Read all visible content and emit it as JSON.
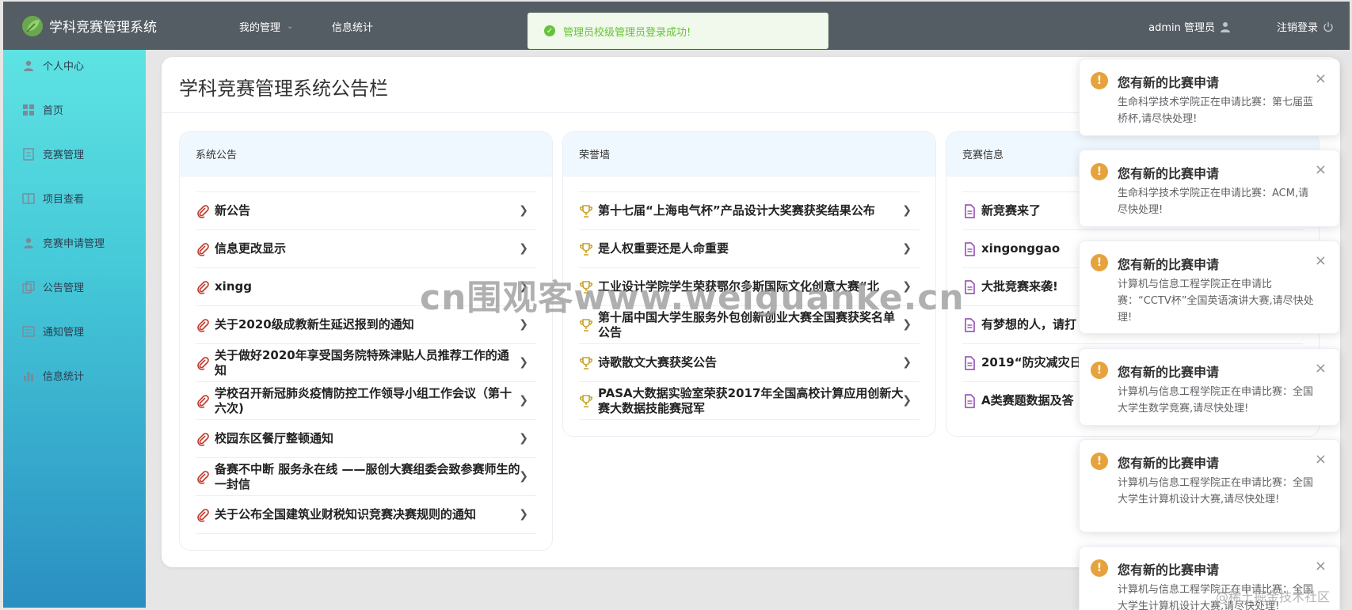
{
  "header": {
    "app_title": "学科竞赛管理系统",
    "nav": [
      {
        "label": "我的管理",
        "has_dropdown": true
      },
      {
        "label": "信息统计",
        "has_dropdown": false
      }
    ],
    "user_label": "admin 管理员",
    "logout_label": "注销登录",
    "bg_color": "#545c64"
  },
  "message": {
    "text": "管理员校级管理员登录成功!",
    "type": "success"
  },
  "sidebar": {
    "items": [
      {
        "label": "个人中心",
        "icon": "user-icon"
      },
      {
        "label": "首页",
        "icon": "grid-icon"
      },
      {
        "label": "竞赛管理",
        "icon": "file-icon"
      },
      {
        "label": "项目查看",
        "icon": "book-icon"
      },
      {
        "label": "竞赛申请管理",
        "icon": "user-icon"
      },
      {
        "label": "公告管理",
        "icon": "copy-icon"
      },
      {
        "label": "通知管理",
        "icon": "document-icon"
      },
      {
        "label": "信息统计",
        "icon": "bar-chart-icon"
      }
    ]
  },
  "main": {
    "title": "学科竞赛管理系统公告栏",
    "panels": [
      {
        "header": "系统公告",
        "icon": "paperclip-icon",
        "items": [
          "新公告",
          "信息更改显示",
          "xingg",
          "关于2020级成教新生延迟报到的通知",
          "关于做好2020年享受国务院特殊津贴人员推荐工作的通知",
          "学校召开新冠肺炎疫情防控工作领导小组工作会议（第十六次)",
          "校园东区餐厅整顿通知",
          "备赛不中断 服务永在线 ——服创大赛组委会致参赛师生的一封信",
          "关于公布全国建筑业财税知识竞赛决赛规则的通知"
        ]
      },
      {
        "header": "荣誉墙",
        "icon": "trophy-icon",
        "items": [
          "第十七届“上海电气杯”产品设计大奖赛获奖结果公布",
          "是人权重要还是人命重要",
          "工业设计学院学生荣获鄂尔多斯国际文化创意大赛“北",
          "第十届中国大学生服务外包创新创业大赛全国赛获奖名单公告",
          "诗歌散文大赛获奖公告",
          "PASA大数据实验室荣获2017年全国高校计算应用创新大赛大数据技能赛冠军"
        ]
      },
      {
        "header": "竞赛信息",
        "icon": "doc-icon",
        "items": [
          "新竞赛来了",
          "xingonggao",
          "大批竞赛来袭!",
          "有梦想的人，请打",
          "2019“防灾减灾日",
          "A类赛题数据及答"
        ]
      }
    ]
  },
  "notifications": [
    {
      "title": "您有新的比赛申请",
      "body": "生命科学技术学院正在申请比赛：第七届蓝桥杯,请尽快处理!"
    },
    {
      "title": "您有新的比赛申请",
      "body": "生命科学技术学院正在申请比赛：ACM,请尽快处理!"
    },
    {
      "title": "您有新的比赛申请",
      "body": "计算机与信息工程学院正在申请比赛：“CCTV杯”全国英语演讲大赛,请尽快处理!"
    },
    {
      "title": "您有新的比赛申请",
      "body": "计算机与信息工程学院正在申请比赛：全国大学生数学竞赛,请尽快处理!"
    },
    {
      "title": "您有新的比赛申请",
      "body": "计算机与信息工程学院正在申请比赛：全国大学生计算机设计大赛,请尽快处理!"
    },
    {
      "title": "您有新的比赛申请",
      "body": "计算机与信息工程学院正在申请比赛：全国大学生计算机设计大赛,请尽快处理!"
    }
  ],
  "watermark": {
    "main": "cn围观客www.weiguanke.cn",
    "corner": "@稀土掘金技术社区"
  },
  "colors": {
    "success": "#67c23a",
    "warning": "#e6a23c",
    "panel_head_bg": "#f0f8ff"
  }
}
